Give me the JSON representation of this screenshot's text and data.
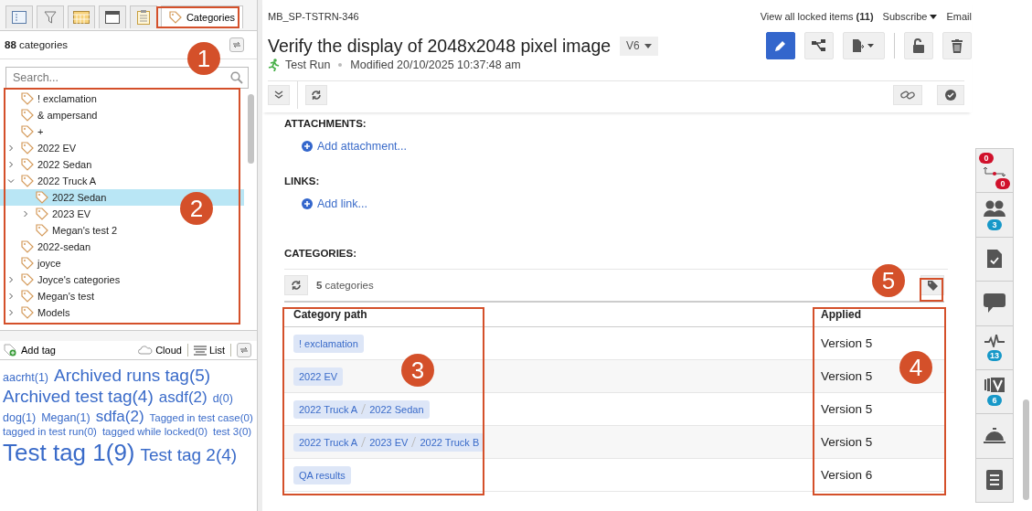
{
  "left_panel": {
    "tabs": [
      {
        "kind": "list",
        "selected": false
      },
      {
        "kind": "filter",
        "selected": false
      },
      {
        "kind": "calendar",
        "selected": false
      },
      {
        "kind": "window",
        "selected": false
      },
      {
        "kind": "clipboard",
        "selected": false
      },
      {
        "kind": "tag",
        "label": "Categories",
        "selected": true
      }
    ],
    "count": "**88** categories",
    "search": {
      "placeholder": "Search..."
    },
    "tree": [
      {
        "label": "! exclamation",
        "expandable": false,
        "selected": false
      },
      {
        "label": "& ampersand",
        "expandable": false,
        "selected": false
      },
      {
        "label": "+",
        "expandable": false,
        "selected": false
      },
      {
        "label": "2022 EV",
        "expandable": true,
        "expanded": false,
        "selected": false
      },
      {
        "label": "2022 Sedan",
        "expandable": true,
        "expanded": false,
        "selected": false
      },
      {
        "label": "2022 Truck A",
        "expandable": true,
        "expanded": true,
        "selected": false,
        "children": [
          {
            "label": "2022 Sedan",
            "expandable": false,
            "selected": true
          },
          {
            "label": "2023 EV",
            "expandable": true,
            "expanded": false,
            "selected": false
          },
          {
            "label": "Megan's test 2",
            "expandable": false,
            "selected": false
          }
        ]
      },
      {
        "label": "2022-sedan",
        "expandable": false,
        "selected": false
      },
      {
        "label": "joyce",
        "expandable": false,
        "selected": false
      },
      {
        "label": "Joyce's categories",
        "expandable": true,
        "expanded": false,
        "selected": false
      },
      {
        "label": "Megan's test",
        "expandable": true,
        "expanded": false,
        "selected": false
      },
      {
        "label": "Models",
        "expandable": true,
        "expanded": false,
        "selected": false
      }
    ],
    "tag_toolbar": {
      "add": "Add tag",
      "cloud": "Cloud",
      "list": "List"
    },
    "tag_cloud": [
      {
        "label": "aacrht(1)",
        "kind": "small"
      },
      {
        "label": "Archived runs tag(5)",
        "kind": "large"
      },
      {
        "label": "Archived test tag(4)",
        "kind": "large"
      },
      {
        "label": "asdf(2)",
        "kind": "medium"
      },
      {
        "label": "d(0)",
        "kind": "small"
      },
      {
        "label": "dog(1)",
        "kind": "small"
      },
      {
        "label": "Megan(1)",
        "kind": "small"
      },
      {
        "label": "sdfa(2)",
        "kind": "medium"
      },
      {
        "label": "Tagged in test case(0)",
        "kind": "tiny"
      },
      {
        "label": "tagged in test run(0)",
        "kind": "tiny"
      },
      {
        "label": "tagged while locked(0)",
        "kind": "tiny"
      },
      {
        "label": "test 3(0)",
        "kind": "tiny"
      },
      {
        "label": "Test tag 1(9)",
        "kind": "xlarge"
      },
      {
        "label": "Test tag 2(4)",
        "kind": "large"
      }
    ]
  },
  "item": {
    "id": "MB_SP-TSTRN-346",
    "locked_link": "View all locked items **(11)**",
    "subscribe": "Subscribe",
    "email": "Email",
    "title": "Verify the display of 2048x2048 pixel image",
    "version": "V6",
    "type": "Test Run",
    "modified": "Modified 20/10/2025 10:37:48 am",
    "sections": [
      {
        "heading": "ATTACHMENTS:",
        "action": "Add attachment..."
      },
      {
        "heading": "LINKS:",
        "action": "Add link..."
      }
    ],
    "categories": {
      "heading": "CATEGORIES:",
      "count": "**5** categories",
      "columns": [
        "Category path",
        "Applied"
      ],
      "rows": [
        {
          "path": [
            "! exclamation"
          ],
          "applied": "Version 5"
        },
        {
          "path": [
            "2022 EV"
          ],
          "applied": "Version 5"
        },
        {
          "path": [
            "2022 Truck A",
            "2022 Sedan"
          ],
          "applied": "Version 5"
        },
        {
          "path": [
            "2022 Truck A",
            "2023 EV",
            "2022 Truck B"
          ],
          "applied": "Version 5"
        },
        {
          "path": [
            "QA results"
          ],
          "applied": "Version 6"
        }
      ]
    }
  },
  "side_rail": [
    {
      "kind": "relations",
      "badges": [
        "0",
        "0"
      ]
    },
    {
      "kind": "people",
      "badges": [
        "3"
      ]
    },
    {
      "kind": "document"
    },
    {
      "kind": "comment"
    },
    {
      "kind": "activity",
      "badges": [
        "13"
      ]
    },
    {
      "kind": "versions",
      "badges": [
        "6"
      ]
    },
    {
      "kind": "bell"
    },
    {
      "kind": "menu"
    }
  ],
  "annotations": [
    {
      "number": "1"
    },
    {
      "number": "2"
    },
    {
      "number": "3"
    },
    {
      "number": "4"
    },
    {
      "number": "5"
    }
  ]
}
